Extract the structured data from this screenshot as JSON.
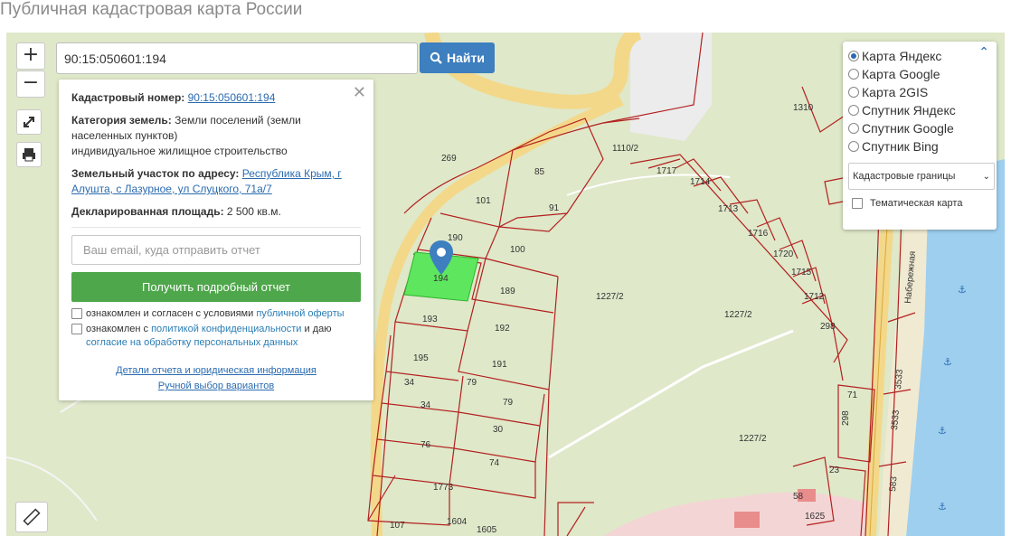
{
  "page": {
    "title": "Публичная кадастровая карта России"
  },
  "controls": {
    "zoom_in": "+",
    "zoom_out": "−"
  },
  "search": {
    "value": "90:15:050601:194",
    "button_label": "Найти"
  },
  "info": {
    "cadastral_label": "Кадастровый номер:",
    "cadastral_value": "90:15:050601:194",
    "category_label": "Категория земель:",
    "category_value": "Земли поселений (земли населенных пунктов)",
    "usage_value": "индивидуальное жилищное строительство",
    "address_label": "Земельный участок по адресу:",
    "address_value": "Республика Крым, г Алушта, с Лазурное, ул Слуцкого, 71а/7",
    "area_label": "Декларированная площадь:",
    "area_value": "2 500 кв.м.",
    "email_placeholder": "Ваш email, куда отправить отчет",
    "report_button": "Получить подробный отчет",
    "consent1_prefix": "ознакомлен и согласен с условиями",
    "consent1_link": "публичной оферты",
    "consent2_prefix": "ознакомлен с",
    "consent2_link": "политикой конфиденциальности",
    "consent2_middle": "и даю",
    "consent2_link2": "согласие на обработку персональных данных",
    "details_link": "Детали отчета и юридическая информация",
    "manual_link": "Ручной выбор вариантов"
  },
  "layers": {
    "options": [
      "Карта Яндекс",
      "Карта Google",
      "Карта 2GIS",
      "Спутник Яндекс",
      "Спутник Google",
      "Спутник Bing"
    ],
    "selected": "Карта Яндекс",
    "overlay_select": "Кадастровые границы",
    "thematic_label": "Тематическая карта"
  },
  "map": {
    "street_label": "Набережная",
    "parcel_labels": [
      "269",
      "85",
      "101",
      "91",
      "1110/2",
      "1717",
      "1714",
      "1713",
      "1716",
      "1720",
      "1715",
      "1712",
      "298",
      "1310",
      "190",
      "100",
      "194",
      "189",
      "1227/2",
      "1227/2",
      "193",
      "192",
      "195",
      "191",
      "34",
      "79",
      "79",
      "34",
      "30",
      "76",
      "74",
      "1773",
      "1227/2",
      "71",
      "298",
      "3533",
      "3533",
      "583",
      "23",
      "58",
      "1625",
      "107",
      "1604",
      "1605"
    ],
    "selected_parcel": "194",
    "colors": {
      "parcel_border": "#b32020",
      "selected_fill": "#5ee65e",
      "sea": "#9ecfef",
      "road": "#f3d88a",
      "ground": "#dfe8c9"
    }
  }
}
